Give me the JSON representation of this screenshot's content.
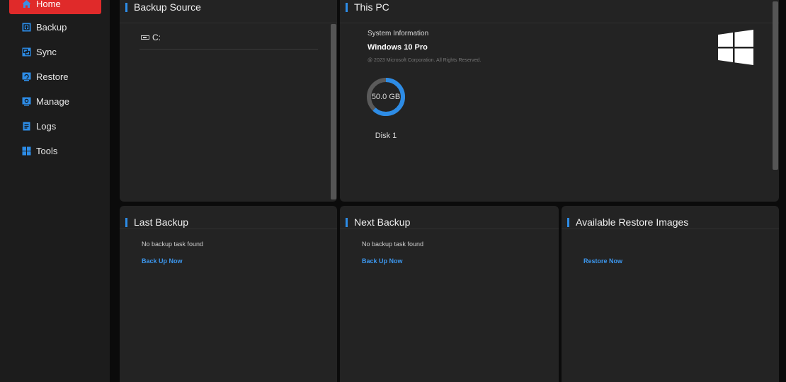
{
  "sidebar": {
    "items": [
      {
        "label": "Home",
        "icon": "home-icon",
        "active": true
      },
      {
        "label": "Backup",
        "icon": "backup-icon"
      },
      {
        "label": "Sync",
        "icon": "sync-icon"
      },
      {
        "label": "Restore",
        "icon": "restore-icon"
      },
      {
        "label": "Manage",
        "icon": "manage-icon"
      },
      {
        "label": "Logs",
        "icon": "logs-icon"
      },
      {
        "label": "Tools",
        "icon": "tools-icon"
      }
    ]
  },
  "backup_source": {
    "title": "Backup Source",
    "drives": [
      {
        "label": "C:"
      }
    ]
  },
  "this_pc": {
    "title": "This PC",
    "system_info_label": "System Information",
    "os_name": "Windows 10 Pro",
    "copyright": "@ 2023 Microsoft Corporation. All Rights Reserved.",
    "disk": {
      "size": "50.0 GB",
      "label": "Disk 1",
      "used_fraction": 0.62
    }
  },
  "last_backup": {
    "title": "Last Backup",
    "status": "No backup task found",
    "action": "Back Up Now"
  },
  "next_backup": {
    "title": "Next Backup",
    "status": "No backup task found",
    "action": "Back Up Now"
  },
  "restore_images": {
    "title": "Available Restore Images",
    "action": "Restore Now"
  },
  "colors": {
    "accent": "#2d8ce6",
    "active_nav": "#e02a2a",
    "panel_bg": "#232323",
    "link": "#3c97ee"
  }
}
